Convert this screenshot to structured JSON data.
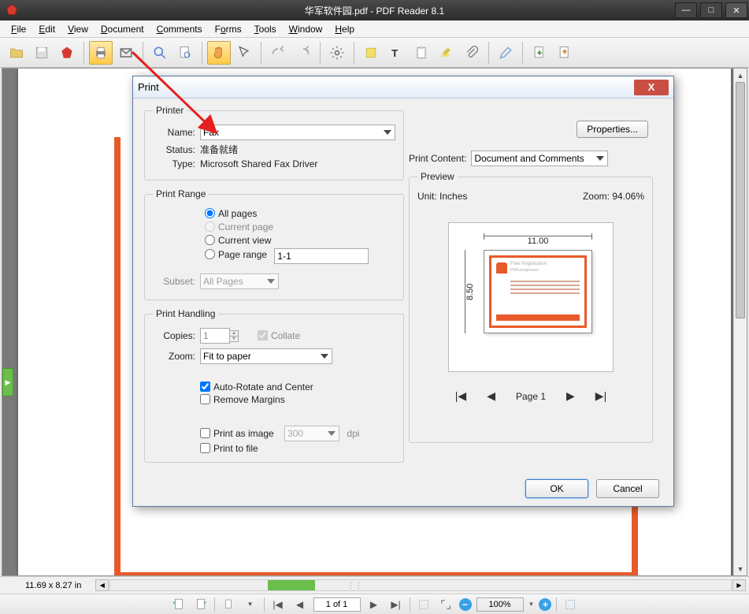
{
  "window": {
    "title": "华军软件园.pdf - PDF Reader 8.1"
  },
  "menu": {
    "file": "File",
    "edit": "Edit",
    "view": "View",
    "document": "Document",
    "comments": "Comments",
    "forms": "Forms",
    "tools": "Tools",
    "window": "Window",
    "help": "Help"
  },
  "dialog": {
    "title": "Print",
    "printer": {
      "legend": "Printer",
      "name_label": "Name:",
      "name": "Fax",
      "properties": "Properties...",
      "status_label": "Status:",
      "status": "准备就绪",
      "type_label": "Type:",
      "type": "Microsoft Shared Fax Driver",
      "print_content_label": "Print Content:",
      "print_content": "Document and Comments"
    },
    "range": {
      "legend": "Print Range",
      "all": "All  pages",
      "current_page": "Current page",
      "current_view": "Current view",
      "page_range": "Page range",
      "range_value": "1-1",
      "subset_label": "Subset:",
      "subset": "All Pages"
    },
    "handling": {
      "legend": "Print Handling",
      "copies_label": "Copies:",
      "copies": "1",
      "collate": "Collate",
      "zoom_label": "Zoom:",
      "zoom": "Fit to paper",
      "auto_rotate": "Auto-Rotate and Center",
      "remove_margins": "Remove Margins",
      "print_image": "Print as image",
      "dpi": "300",
      "dpi_label": "dpi",
      "print_file": "Print to file"
    },
    "preview": {
      "legend": "Preview",
      "unit_label": "Unit: Inches",
      "zoom_label": "Zoom: 94.06%",
      "width": "11.00",
      "height": "8.50",
      "inner_title": "Free Registration",
      "inner_sub": "PDFcompressor",
      "pager": "Page 1"
    },
    "ok": "OK",
    "cancel": "Cancel"
  },
  "status": {
    "dimensions": "11.69 x 8.27 in"
  },
  "nav": {
    "page": "1 of 1",
    "zoom": "100%"
  }
}
